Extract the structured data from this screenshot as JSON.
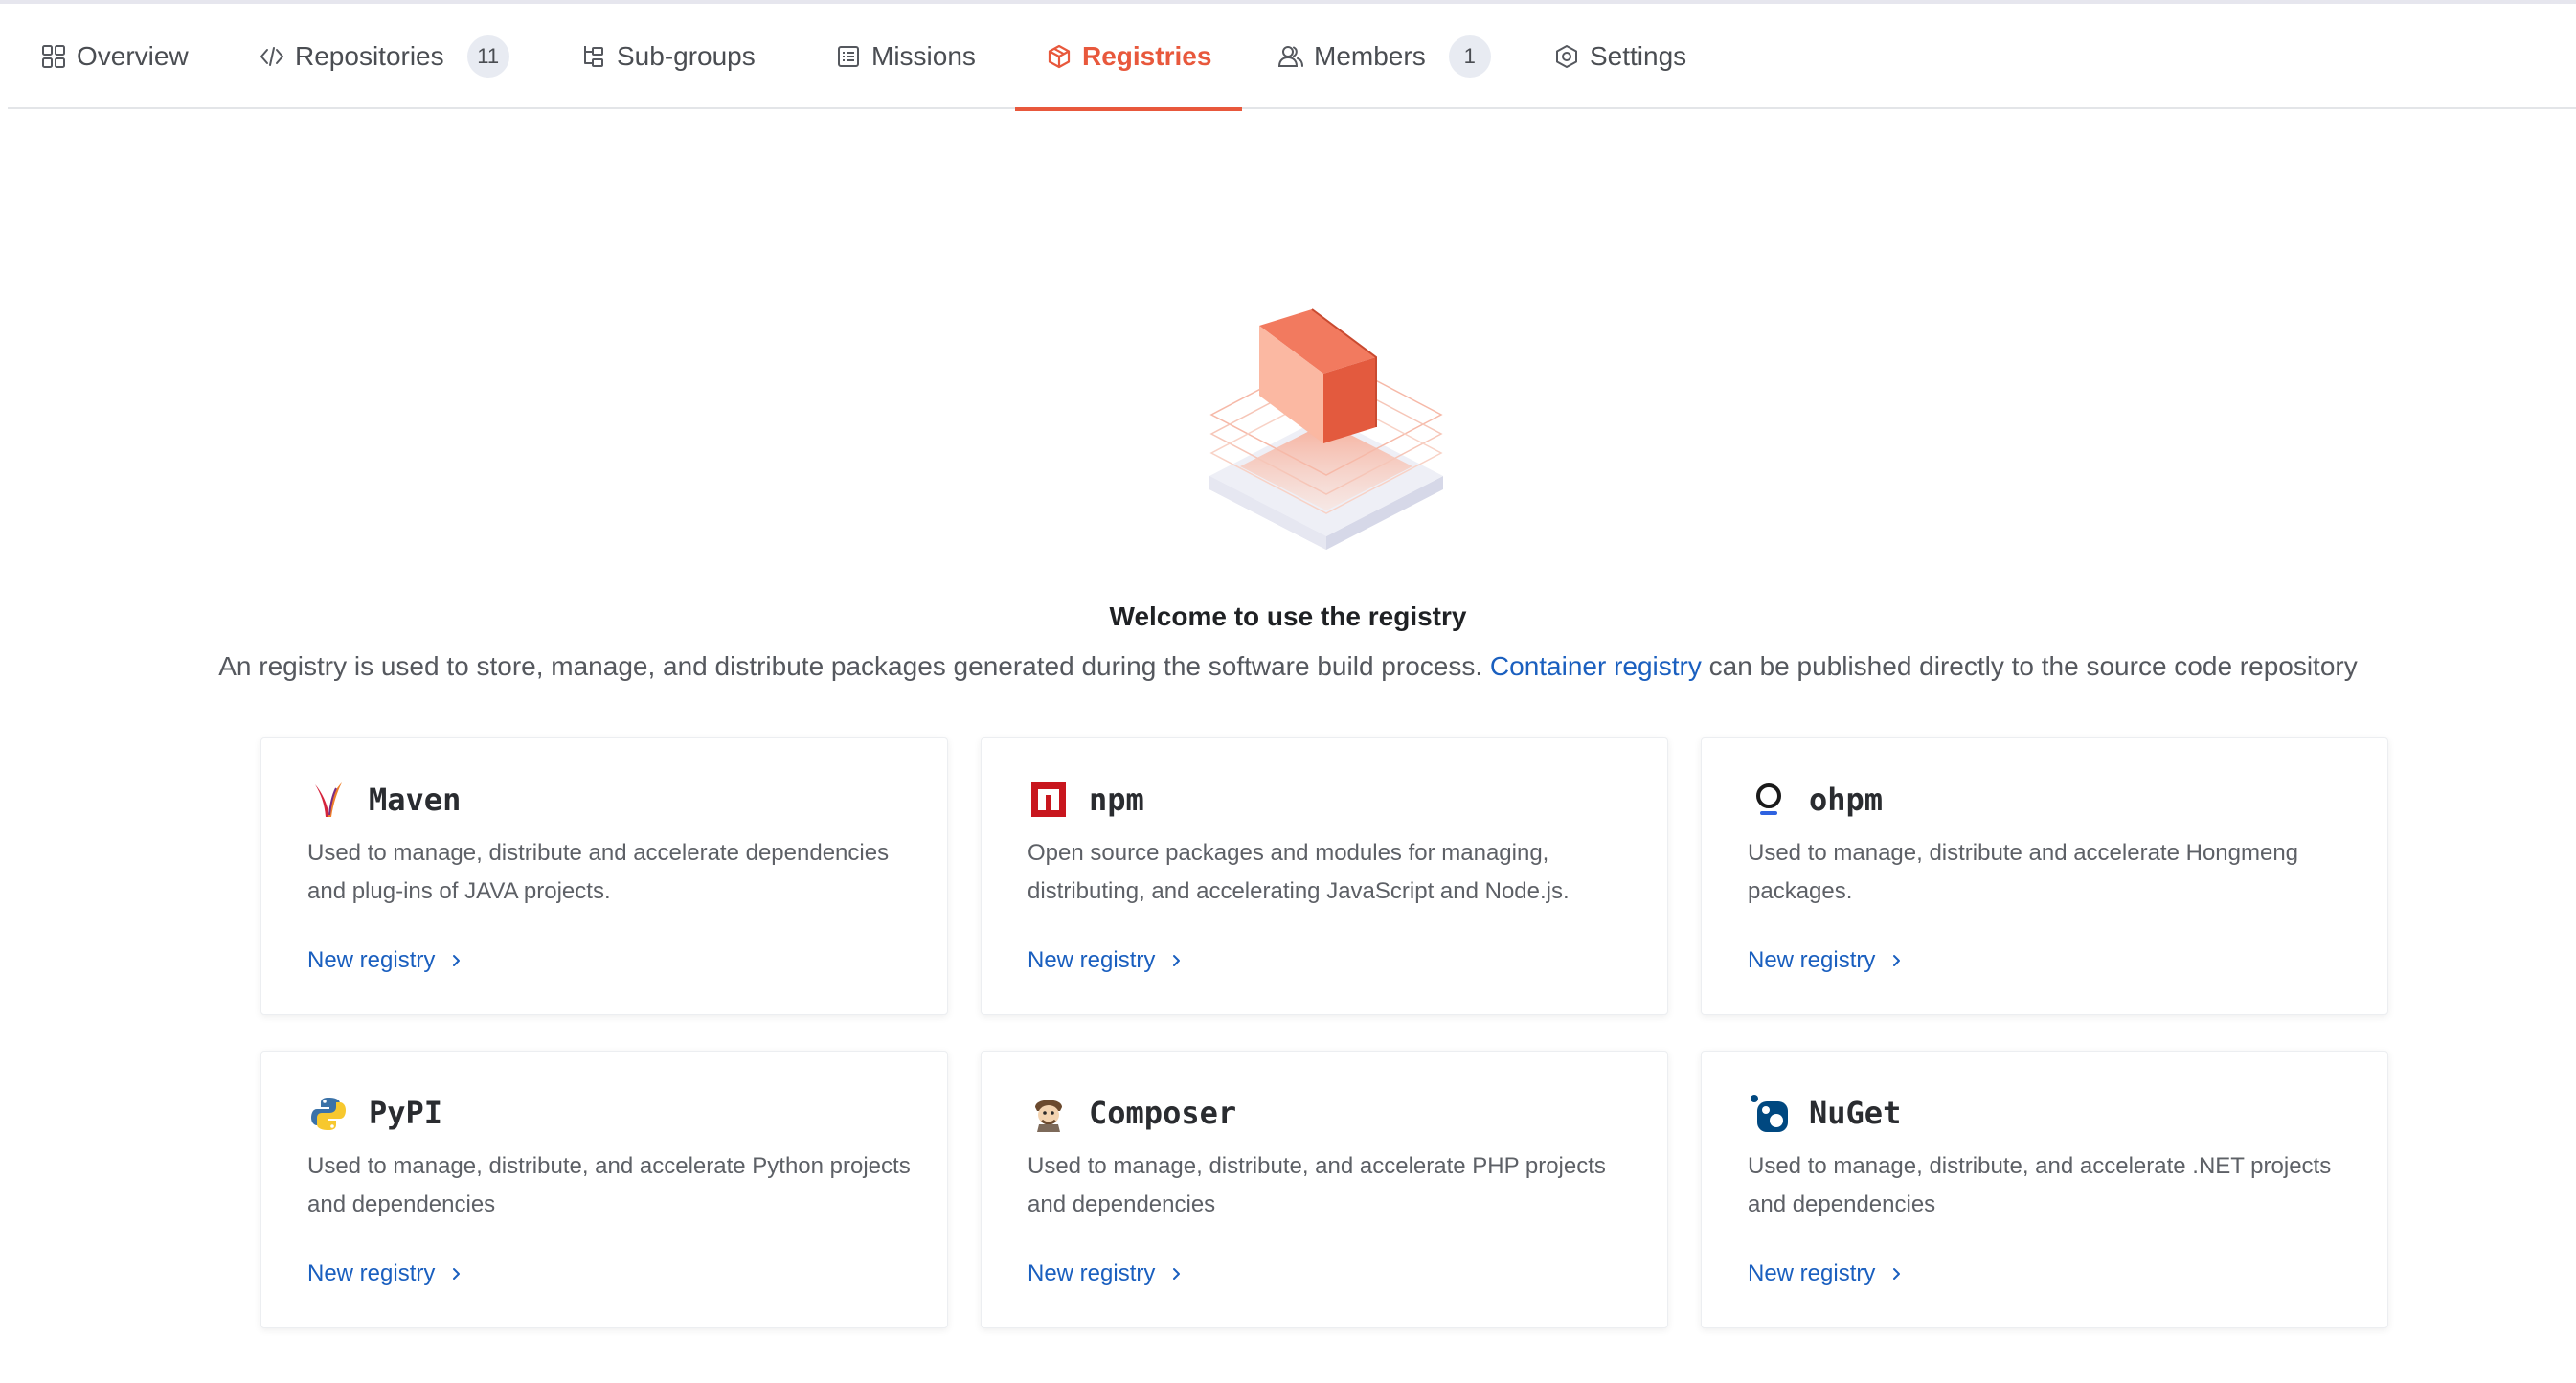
{
  "tabs": [
    {
      "label": "Overview",
      "icon": "grid-icon"
    },
    {
      "label": "Repositories",
      "icon": "code-icon",
      "badge": "11"
    },
    {
      "label": "Sub-groups",
      "icon": "subgroup-tree-icon"
    },
    {
      "label": "Missions",
      "icon": "list-icon"
    },
    {
      "label": "Registries",
      "icon": "package-cube-icon",
      "active": true
    },
    {
      "label": "Members",
      "icon": "users-icon",
      "badge": "1"
    },
    {
      "label": "Settings",
      "icon": "settings-hexagon-icon"
    }
  ],
  "colors": {
    "accent": "#e8583c",
    "link": "#1a5fbf",
    "badge_bg": "#e8ebf2"
  },
  "hero": {
    "title": "Welcome to use the registry",
    "description_before": "An registry is used to store, manage, and distribute packages generated during the software build process. ",
    "link_text": "Container registry",
    "description_after": " can be published directly to the source code repository"
  },
  "cards": [
    {
      "name": "Maven",
      "icon": "maven-feather-icon",
      "description": "Used to manage, distribute and accelerate dependencies and plug-ins of JAVA projects.",
      "action": "New registry"
    },
    {
      "name": "npm",
      "icon": "npm-logo-icon",
      "description": "Open source packages and modules for managing, distributing, and accelerating JavaScript and Node.js.",
      "action": "New registry"
    },
    {
      "name": "ohpm",
      "icon": "ohpm-logo-icon",
      "description": "Used to manage, distribute and accelerate Hongmeng packages.",
      "action": "New registry"
    },
    {
      "name": "PyPI",
      "icon": "python-logo-icon",
      "description": "Used to manage, distribute, and accelerate Python projects and dependencies",
      "action": "New registry"
    },
    {
      "name": "Composer",
      "icon": "composer-logo-icon",
      "description": "Used to manage, distribute, and accelerate PHP projects and dependencies",
      "action": "New registry"
    },
    {
      "name": "NuGet",
      "icon": "nuget-logo-icon",
      "description": "Used to manage, distribute, and accelerate .NET projects and dependencies",
      "action": "New registry"
    }
  ]
}
